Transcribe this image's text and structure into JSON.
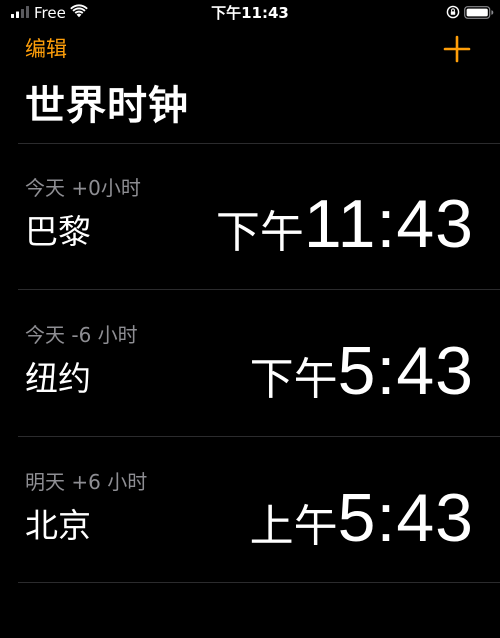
{
  "status_bar": {
    "carrier": "Free",
    "time": "下午11:43"
  },
  "nav": {
    "edit_label": "编辑",
    "add_icon": "plus-icon",
    "title": "世界时钟"
  },
  "colors": {
    "accent": "#ff9f0a",
    "secondary_text": "#8e8e93",
    "background": "#000000",
    "divider": "#2b2b2d"
  },
  "clocks": [
    {
      "offset": "今天 +0小时",
      "city": "巴黎",
      "period": "下午",
      "time": "11:43"
    },
    {
      "offset": "今天 -6 小时",
      "city": "纽约",
      "period": "下午",
      "time": "5:43"
    },
    {
      "offset": "明天 +6 小时",
      "city": "北京",
      "period": "上午",
      "time": "5:43"
    }
  ]
}
